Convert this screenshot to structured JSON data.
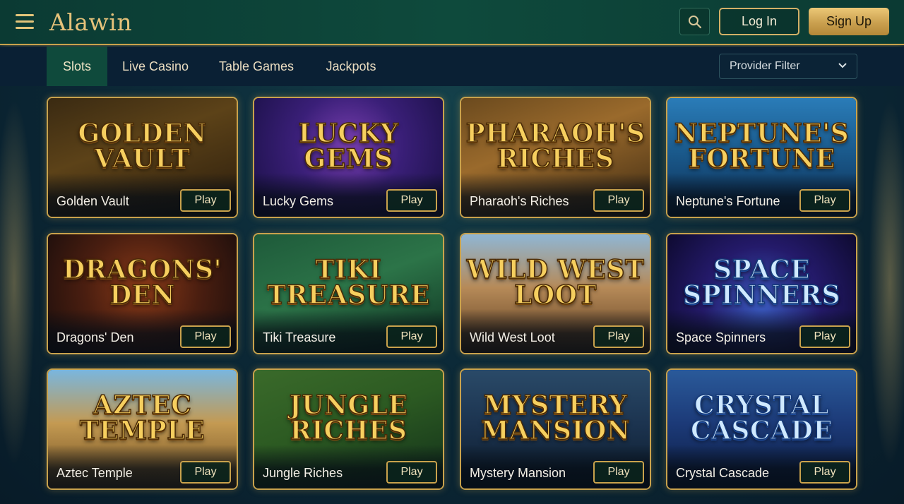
{
  "header": {
    "logo": "Alawin",
    "login_label": "Log In",
    "signup_label": "Sign Up"
  },
  "tabs": [
    {
      "label": "Slots",
      "active": true
    },
    {
      "label": "Live Casino",
      "active": false
    },
    {
      "label": "Table Games",
      "active": false
    },
    {
      "label": "Jackpots",
      "active": false
    }
  ],
  "provider_filter": {
    "label": "Provider Filter"
  },
  "games": [
    {
      "art": [
        "GOLDEN",
        "VAULT"
      ],
      "name": "Golden Vault",
      "play": "Play",
      "theme": "vault"
    },
    {
      "art": [
        "LUCKY",
        "GEMS"
      ],
      "name": "Lucky Gems",
      "play": "Play",
      "theme": "gems"
    },
    {
      "art": [
        "PHARAOH'S",
        "RICHES"
      ],
      "name": "Pharaoh's Riches",
      "play": "Play",
      "theme": "egypt"
    },
    {
      "art": [
        "NEPTUNE'S",
        "FORTUNE"
      ],
      "name": "Neptune's Fortune",
      "play": "Play",
      "theme": "sea"
    },
    {
      "art": [
        "DRAGONS'",
        "DEN"
      ],
      "name": "Dragons' Den",
      "play": "Play",
      "theme": "dragon"
    },
    {
      "art": [
        "TIKI",
        "TREASURE"
      ],
      "name": "Tiki Treasure",
      "play": "Play",
      "theme": "tiki"
    },
    {
      "art": [
        "WILD WEST",
        "LOOT"
      ],
      "name": "Wild West Loot",
      "play": "Play",
      "theme": "west"
    },
    {
      "art": [
        "SPACE",
        "SPINNERS"
      ],
      "name": "Space Spinners",
      "play": "Play",
      "theme": "space"
    },
    {
      "art": [
        "AZTEC",
        "TEMPLE"
      ],
      "name": "Aztec Temple",
      "play": "Play",
      "theme": "aztec"
    },
    {
      "art": [
        "JUNGLE",
        "RICHES"
      ],
      "name": "Jungle Riches",
      "play": "Play",
      "theme": "jungle"
    },
    {
      "art": [
        "MYSTERY",
        "MANSION"
      ],
      "name": "Mystery Mansion",
      "play": "Play",
      "theme": "mansion"
    },
    {
      "art": [
        "CRYSTAL",
        "CASCADE"
      ],
      "name": "Crystal Cascade",
      "play": "Play",
      "theme": "crystal"
    }
  ],
  "colors": {
    "gold": "#c9a24c",
    "header_green": "#0e4a3c",
    "tabbar": "#0a2034"
  }
}
